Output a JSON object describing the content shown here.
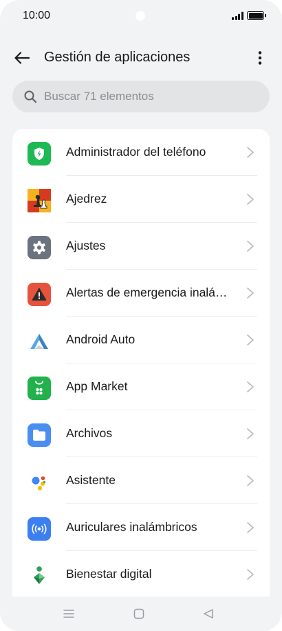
{
  "status_bar": {
    "time": "10:00"
  },
  "header": {
    "title": "Gestión de aplicaciones",
    "back_icon": "arrow-left-icon",
    "menu_icon": "more-vertical-icon"
  },
  "search": {
    "placeholder": "Buscar 71 elementos",
    "value": ""
  },
  "apps": [
    {
      "label": "Administrador del teléfono",
      "icon": "phone-manager-shield-icon",
      "color": "#1db954"
    },
    {
      "label": "Ajedrez",
      "icon": "chess-icon",
      "color": "#e8731c"
    },
    {
      "label": "Ajustes",
      "icon": "settings-gear-icon",
      "color": "#6b7280"
    },
    {
      "label": "Alertas de emergencia inalá…",
      "icon": "emergency-alert-icon",
      "color": "#e5533d"
    },
    {
      "label": "Android Auto",
      "icon": "android-auto-icon",
      "color": "#3b82c4"
    },
    {
      "label": "App Market",
      "icon": "app-market-bag-icon",
      "color": "#22b14c"
    },
    {
      "label": "Archivos",
      "icon": "folder-icon",
      "color": "#4a8ff0"
    },
    {
      "label": "Asistente",
      "icon": "assistant-dots-icon",
      "color": "#4285f4"
    },
    {
      "label": "Auriculares inalámbricos",
      "icon": "wireless-earbuds-icon",
      "color": "#3b7ff0"
    },
    {
      "label": "Bienestar digital",
      "icon": "digital-wellbeing-icon",
      "color": "#2f9e5a"
    }
  ],
  "nav_bar": {
    "recents_icon": "menu-lines-icon",
    "home_icon": "home-square-icon",
    "back_icon": "back-triangle-icon"
  }
}
